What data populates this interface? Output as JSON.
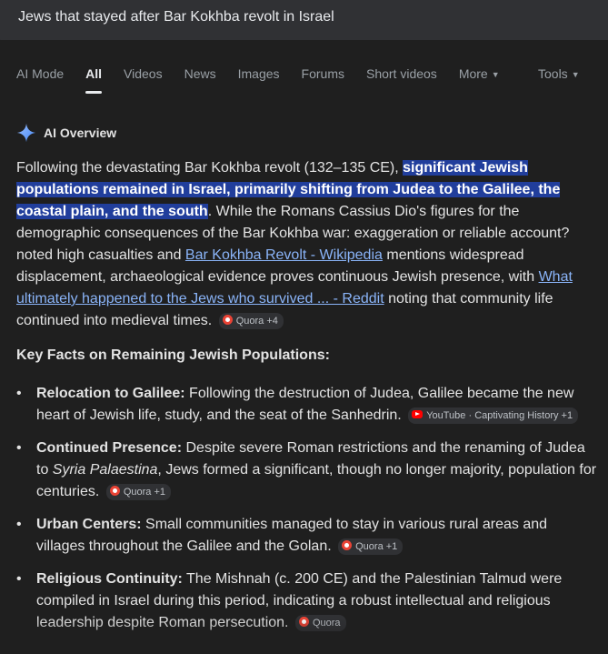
{
  "search": {
    "query": "Jews that stayed after Bar Kokhba revolt in Israel"
  },
  "tabs": [
    "AI Mode",
    "All",
    "Videos",
    "News",
    "Images",
    "Forums",
    "Short videos",
    "More"
  ],
  "active_tab": "All",
  "tools_label": "Tools",
  "ai_overview": {
    "label": "AI Overview",
    "p1": "Following the devastating Bar Kokhba revolt (132–135 CE),",
    "highlight": "significant Jewish populations remained in Israel, primarily shifting from Judea to the Galilee, the coastal plain, and the south",
    "p2": ". While the Romans Cassius Dio's figures for the demographic consequences of the Bar Kokhba war: exaggeration or reliable account? noted high casualties and",
    "link1": "Bar Kokhba Revolt - Wikipedia",
    "p3": "mentions widespread displacement, archaeological evidence proves continuous Jewish presence, with",
    "link2": "What ultimately happened to the Jews who survived ... - Reddit",
    "p4": "noting that community life continued into medieval times.",
    "chip": "Quora +4"
  },
  "key_facts": {
    "title": "Key Facts on Remaining Jewish Populations:",
    "items": [
      {
        "bold": "Relocation to Galilee:",
        "text": "Following the destruction of Judea, Galilee became the new heart of Jewish life, study, and the seat of the Sanhedrin.",
        "chip": "YouTube · Captivating History +1"
      },
      {
        "bold": "Continued Presence:",
        "text_a": "Despite severe Roman restrictions and the renaming of Judea to",
        "italic": "Syria Palaestina",
        "text_b": ", Jews formed a significant, though no longer majority, population for centuries.",
        "chip": "Quora +1"
      },
      {
        "bold": "Urban Centers:",
        "text": "Small communities managed to stay in various rural areas and villages throughout the Galilee and the Golan.",
        "chip": "Quora +1"
      },
      {
        "bold": "Religious Continuity:",
        "text": "The Mishnah (c. 200 CE) and the Palestinian Talmud were compiled in Israel during this period, indicating a robust intellectual and religious leadership despite Roman persecution.",
        "chip": "Quora"
      }
    ]
  },
  "colors": {
    "background": "#1f1f1f",
    "highlight": "#213e9c",
    "link": "#8ab4f8",
    "gemini_blue": "#4285f4"
  },
  "icons": {
    "ai_overview": "gemini-sparkle-icon",
    "quora": "quora-icon",
    "youtube": "youtube-icon",
    "dropdown": "chevron-down-icon"
  }
}
